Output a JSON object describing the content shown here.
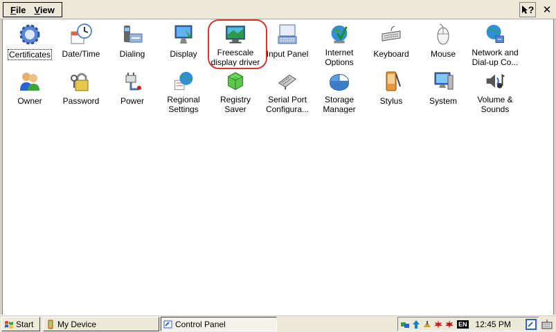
{
  "menu": {
    "file": "File",
    "file_key": "F",
    "file_rest": "ile",
    "view_key": "V",
    "view_rest": "iew"
  },
  "toolbar": {
    "help": "?",
    "close": "✕"
  },
  "icons": [
    {
      "label": "Certificates",
      "icon": "certificates-icon"
    },
    {
      "label": "Date/Time",
      "icon": "date-time-icon"
    },
    {
      "label": "Dialing",
      "icon": "dialing-icon"
    },
    {
      "label": "Display",
      "icon": "display-icon"
    },
    {
      "label": "Freescale\ndisplay driver",
      "icon": "freescale-display-driver-icon"
    },
    {
      "label": "Input Panel",
      "icon": "input-panel-icon"
    },
    {
      "label": "Internet\nOptions",
      "icon": "internet-options-icon"
    },
    {
      "label": "Keyboard",
      "icon": "keyboard-icon"
    },
    {
      "label": "Mouse",
      "icon": "mouse-icon"
    },
    {
      "label": "Network and\nDial-up Co...",
      "icon": "network-icon"
    },
    {
      "label": "Owner",
      "icon": "owner-icon"
    },
    {
      "label": "Password",
      "icon": "password-icon"
    },
    {
      "label": "Power",
      "icon": "power-icon"
    },
    {
      "label": "Regional\nSettings",
      "icon": "regional-settings-icon"
    },
    {
      "label": "Registry\nSaver",
      "icon": "registry-saver-icon"
    },
    {
      "label": "Serial Port\nConfigura...",
      "icon": "serial-port-icon"
    },
    {
      "label": "Storage\nManager",
      "icon": "storage-manager-icon"
    },
    {
      "label": "Stylus",
      "icon": "stylus-icon"
    },
    {
      "label": "System",
      "icon": "system-icon"
    },
    {
      "label": "Volume &\nSounds",
      "icon": "volume-sounds-icon"
    }
  ],
  "taskbar": {
    "start": "Start",
    "my_device": "My Device",
    "control_panel": "Control Panel",
    "lang": "EN",
    "clock": "12:45 PM"
  },
  "colors": {
    "highlight_ring": "#e0302a",
    "desktop_bg": "#ffffff",
    "chrome": "#ece9d8"
  }
}
